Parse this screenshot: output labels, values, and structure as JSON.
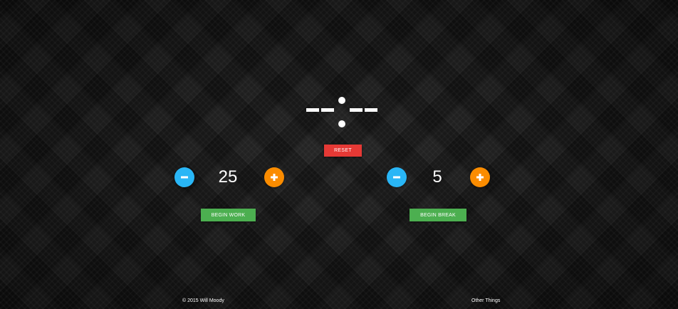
{
  "clock": {
    "display": "--:--"
  },
  "reset": {
    "label": "RESET"
  },
  "work": {
    "value": "25",
    "begin_label": "BEGIN WORK"
  },
  "break": {
    "value": "5",
    "begin_label": "BEGIN BREAK"
  },
  "footer": {
    "copyright": "© 2015 Will Moody",
    "other_link": "Other Things"
  },
  "icons": {
    "minus": "minus-icon",
    "plus": "plus-icon"
  },
  "colors": {
    "reset": "#e53935",
    "minus": "#29b6f6",
    "plus": "#fb8c00",
    "begin": "#4caf50"
  }
}
